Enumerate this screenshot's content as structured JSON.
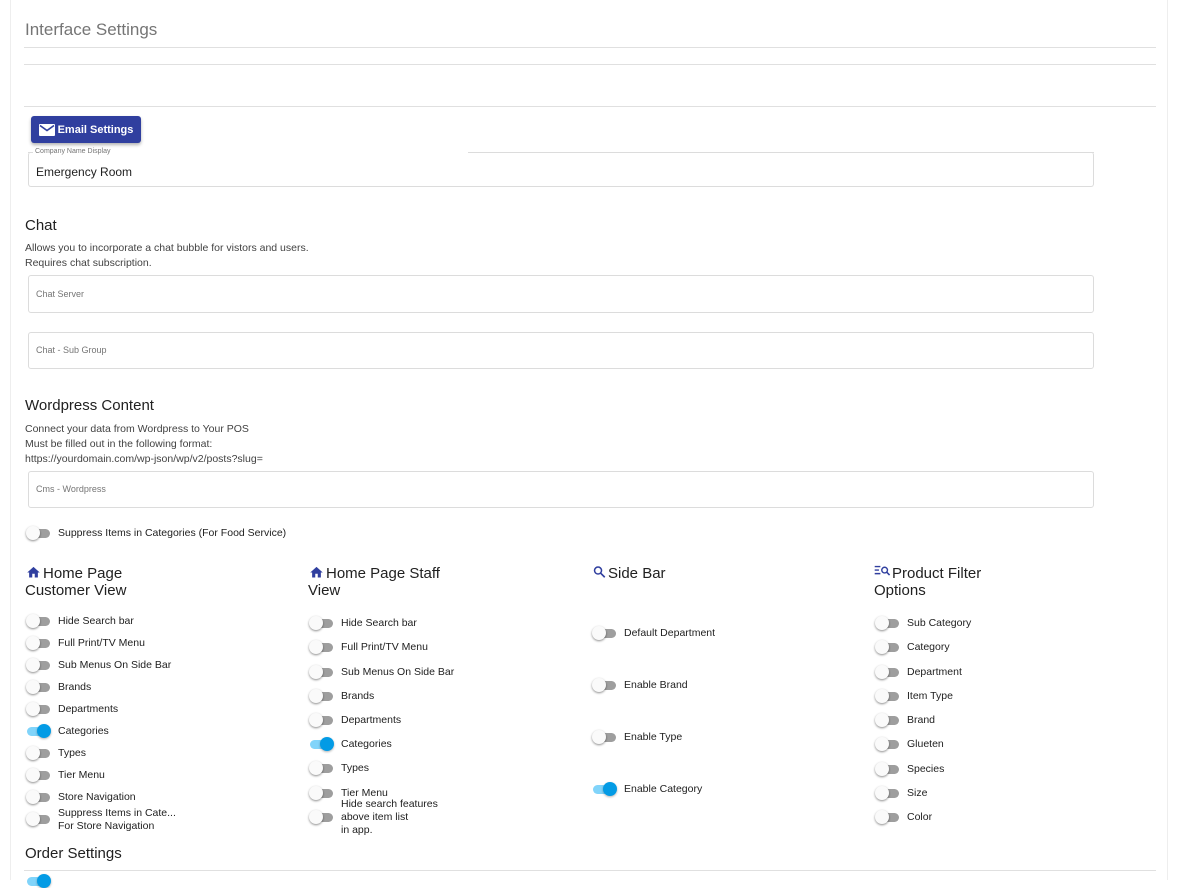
{
  "page": {
    "title": "Interface Settings"
  },
  "email_button": {
    "label": "Email Settings",
    "icon": "mail-icon"
  },
  "company_name": {
    "label": "Company Name Display",
    "value": "Emergency Room"
  },
  "chat": {
    "title": "Chat",
    "desc1": "Allows you to incorporate a chat bubble for vistors and users.",
    "desc2": "Requires chat subscription.",
    "server_placeholder": "Chat Server",
    "subgroup_placeholder": "Chat - Sub Group"
  },
  "wordpress": {
    "title": "Wordpress Content",
    "desc1": "Connect your data from Wordpress to Your POS",
    "desc2": "Must be filled out in the following format:",
    "desc3": "https://yourdomain.com/wp-json/wp/v2/posts?slug=",
    "placeholder": "Cms - Wordpress"
  },
  "suppress_food": {
    "label": "Suppress Items in Categories (For Food Service)",
    "on": false
  },
  "home_customer": {
    "title_line1": "Home Page",
    "title_line2": "Customer View",
    "icon": "home-icon",
    "items": [
      {
        "label": "Hide Search bar",
        "on": false
      },
      {
        "label": "Full Print/TV Menu",
        "on": false
      },
      {
        "label": "Sub Menus On Side Bar",
        "on": false
      },
      {
        "label": "Brands",
        "on": false
      },
      {
        "label": "Departments",
        "on": false
      },
      {
        "label": "Categories",
        "on": true
      },
      {
        "label": "Types",
        "on": false
      },
      {
        "label": "Tier Menu",
        "on": false
      },
      {
        "label": "Store Navigation",
        "on": false
      }
    ],
    "suppress_line1": "Suppress Items in Cate...",
    "suppress_line2": "For Store Navigation"
  },
  "home_staff": {
    "title_line1": "Home Page Staff",
    "title_line2": "View",
    "icon": "home-icon",
    "items": [
      {
        "label": "Hide Search bar",
        "on": false
      },
      {
        "label": "Full Print/TV Menu",
        "on": false
      },
      {
        "label": "Sub Menus On Side Bar",
        "on": false
      },
      {
        "label": "Brands",
        "on": false
      },
      {
        "label": "Departments",
        "on": false
      },
      {
        "label": "Categories",
        "on": true
      },
      {
        "label": "Types",
        "on": false
      },
      {
        "label": "Tier Menu",
        "on": false
      }
    ],
    "hide_line1": "Hide search features",
    "hide_line2": "above item list",
    "hide_line3": "in app."
  },
  "side_bar": {
    "title": "Side Bar",
    "icon": "search-icon",
    "items": [
      {
        "label": "Default Department",
        "on": false
      },
      {
        "label": "Enable Brand",
        "on": false
      },
      {
        "label": "Enable Type",
        "on": false
      },
      {
        "label": "Enable Category",
        "on": true
      }
    ]
  },
  "product_filter": {
    "title_line1": "Product Filter",
    "title_line2": "Options",
    "icon": "filter-search-icon",
    "items": [
      {
        "label": "Sub Category",
        "on": false
      },
      {
        "label": "Category",
        "on": false
      },
      {
        "label": "Department",
        "on": false
      },
      {
        "label": "Item Type",
        "on": false
      },
      {
        "label": "Brand",
        "on": false
      },
      {
        "label": "Glueten",
        "on": false
      },
      {
        "label": "Species",
        "on": false
      },
      {
        "label": "Size",
        "on": false
      },
      {
        "label": "Color",
        "on": false
      }
    ]
  },
  "order_settings": {
    "title": "Order Settings"
  },
  "colors": {
    "primary": "#303f9f",
    "toggle_on": "#039be5",
    "toggle_on_track": "#81d4fa",
    "toggle_off_track": "#9e9e9e"
  }
}
